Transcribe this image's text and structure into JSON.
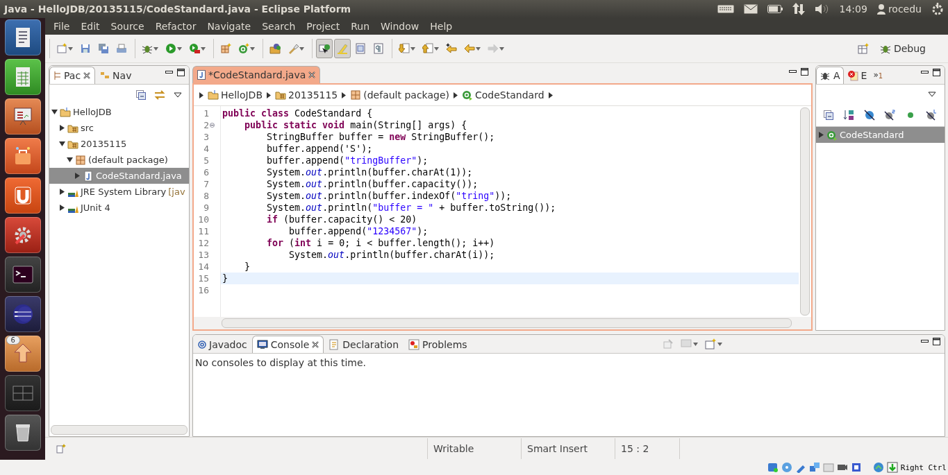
{
  "window": {
    "title": "Java - HelloJDB/20135115/CodeStandard.java - Eclipse Platform"
  },
  "top_panel": {
    "clock": "14:09",
    "user": "rocedu"
  },
  "launcher": [
    {
      "kind": "document"
    },
    {
      "kind": "spreadsheet"
    },
    {
      "kind": "presentation"
    },
    {
      "kind": "store"
    },
    {
      "kind": "cloud"
    },
    {
      "kind": "settings"
    },
    {
      "kind": "terminal"
    },
    {
      "kind": "eclipse"
    },
    {
      "kind": "updater",
      "badge": "6"
    },
    {
      "kind": "workspaces"
    },
    {
      "kind": "trash"
    }
  ],
  "menu": [
    "File",
    "Edit",
    "Source",
    "Refactor",
    "Navigate",
    "Search",
    "Project",
    "Run",
    "Window",
    "Help"
  ],
  "toolbar": [
    [
      {
        "kind": "new",
        "dropdown": true
      },
      {
        "kind": "save"
      },
      {
        "kind": "save_all"
      },
      {
        "kind": "print"
      }
    ],
    [
      {
        "kind": "debug",
        "dropdown": true
      },
      {
        "kind": "run",
        "dropdown": true
      },
      {
        "kind": "external",
        "dropdown": true
      }
    ],
    [
      {
        "kind": "new_package"
      },
      {
        "kind": "new_class",
        "dropdown": true
      }
    ],
    [
      {
        "kind": "open_type"
      },
      {
        "kind": "search",
        "dropdown": true
      }
    ],
    [
      {
        "kind": "breadcrumb",
        "pressed": true
      },
      {
        "kind": "highlight",
        "pressed": true
      },
      {
        "kind": "block",
        "pressed": false
      },
      {
        "kind": "whitespace",
        "pressed": false
      }
    ],
    [
      {
        "kind": "next",
        "dropdown": true
      },
      {
        "kind": "prev",
        "dropdown": true
      },
      {
        "kind": "last_edit"
      },
      {
        "kind": "back",
        "dropdown": true,
        "disabled": false
      },
      {
        "kind": "forward",
        "dropdown": true,
        "disabled": true
      }
    ]
  ],
  "perspective": {
    "label": "Debug"
  },
  "package_explorer": {
    "tabs": [
      {
        "label": "Pac",
        "selected": true
      },
      {
        "label": "Nav",
        "selected": false
      }
    ],
    "tree": [
      {
        "label": "HelloJDB",
        "kind": "project",
        "expanded": true,
        "selected": false,
        "children": [
          {
            "label": "src",
            "kind": "folder",
            "expanded": false,
            "selected": false
          },
          {
            "label": "20135115",
            "kind": "folder",
            "expanded": true,
            "selected": false,
            "children": [
              {
                "label": "(default package)",
                "kind": "package",
                "expanded": true,
                "selected": false,
                "children": [
                  {
                    "label": "CodeStandard.java",
                    "kind": "java",
                    "expanded": false,
                    "selected": true
                  }
                ]
              }
            ]
          },
          {
            "label": "JRE System Library",
            "suffix": "[jav",
            "kind": "library",
            "expanded": false,
            "selected": false
          },
          {
            "label": "JUnit 4",
            "kind": "library",
            "expanded": false,
            "selected": false
          }
        ]
      }
    ]
  },
  "editor": {
    "tab": {
      "label": "*CodeStandard.java",
      "selected": true
    },
    "breadcrumb": [
      {
        "label": "HelloJDB",
        "kind": "project"
      },
      {
        "label": "20135115",
        "kind": "folder"
      },
      {
        "label": "(default package)",
        "kind": "package"
      },
      {
        "label": "CodeStandard",
        "kind": "class"
      }
    ],
    "lines": [
      {
        "number": "1",
        "tokens": [
          {
            "kind": "keyword",
            "text": "public class"
          },
          {
            "kind": "plain",
            "text": " CodeStandard {"
          }
        ]
      },
      {
        "number": "2",
        "fold": true,
        "tokens": [
          {
            "kind": "keyword",
            "text": "    public static void"
          },
          {
            "kind": "plain",
            "text": " main(String[] args) {"
          }
        ]
      },
      {
        "number": "3",
        "tokens": [
          {
            "kind": "plain",
            "text": "        StringBuffer buffer = "
          },
          {
            "kind": "keyword",
            "text": "new"
          },
          {
            "kind": "plain",
            "text": " StringBuffer();"
          }
        ]
      },
      {
        "number": "4",
        "tokens": [
          {
            "kind": "plain",
            "text": "        buffer.append('S');"
          }
        ]
      },
      {
        "number": "5",
        "tokens": [
          {
            "kind": "plain",
            "text": "        buffer.append("
          },
          {
            "kind": "string",
            "text": "\"tringBuffer\""
          },
          {
            "kind": "plain",
            "text": ");"
          }
        ]
      },
      {
        "number": "6",
        "tokens": [
          {
            "kind": "plain",
            "text": "        System."
          },
          {
            "kind": "field",
            "text": "out"
          },
          {
            "kind": "plain",
            "text": ".println(buffer.charAt(1));"
          }
        ]
      },
      {
        "number": "7",
        "tokens": [
          {
            "kind": "plain",
            "text": "        System."
          },
          {
            "kind": "field",
            "text": "out"
          },
          {
            "kind": "plain",
            "text": ".println(buffer.capacity());"
          }
        ]
      },
      {
        "number": "8",
        "tokens": [
          {
            "kind": "plain",
            "text": "        System."
          },
          {
            "kind": "field",
            "text": "out"
          },
          {
            "kind": "plain",
            "text": ".println(buffer.indexOf("
          },
          {
            "kind": "string",
            "text": "\"tring\""
          },
          {
            "kind": "plain",
            "text": "));"
          }
        ]
      },
      {
        "number": "9",
        "tokens": [
          {
            "kind": "plain",
            "text": "        System."
          },
          {
            "kind": "field",
            "text": "out"
          },
          {
            "kind": "plain",
            "text": ".println("
          },
          {
            "kind": "string",
            "text": "\"buffer = \""
          },
          {
            "kind": "plain",
            "text": " + buffer.toString());"
          }
        ]
      },
      {
        "number": "10",
        "tokens": [
          {
            "kind": "keyword",
            "text": "        if"
          },
          {
            "kind": "plain",
            "text": " (buffer.capacity() < 20)"
          }
        ]
      },
      {
        "number": "11",
        "tokens": [
          {
            "kind": "plain",
            "text": "            buffer.append("
          },
          {
            "kind": "string",
            "text": "\"1234567\""
          },
          {
            "kind": "plain",
            "text": ");"
          }
        ]
      },
      {
        "number": "12",
        "tokens": [
          {
            "kind": "keyword",
            "text": "        for"
          },
          {
            "kind": "plain",
            "text": " ("
          },
          {
            "kind": "keyword",
            "text": "int"
          },
          {
            "kind": "plain",
            "text": " i = 0; i < buffer.length(); i++)"
          }
        ]
      },
      {
        "number": "13",
        "tokens": [
          {
            "kind": "plain",
            "text": "            System."
          },
          {
            "kind": "field",
            "text": "out"
          },
          {
            "kind": "plain",
            "text": ".println(buffer.charAt(i));"
          }
        ]
      },
      {
        "number": "14",
        "tokens": [
          {
            "kind": "plain",
            "text": "    }"
          }
        ]
      },
      {
        "number": "15",
        "current": true,
        "tokens": [
          {
            "kind": "plain",
            "text": "}"
          }
        ]
      },
      {
        "number": "16"
      }
    ]
  },
  "outline": {
    "tabs": [
      {
        "label": "A",
        "kind": "bug",
        "selected": true
      },
      {
        "label": "E",
        "kind": "error",
        "selected": false
      }
    ],
    "overflow": {
      "mark": "»",
      "count": "1"
    },
    "items": [
      {
        "label": "CodeStandard",
        "selected": true
      }
    ]
  },
  "bottom_panel": {
    "tabs": [
      {
        "label": "Javadoc",
        "kind": "at",
        "selected": false
      },
      {
        "label": "Console",
        "kind": "console",
        "selected": true
      },
      {
        "label": "Declaration",
        "kind": "declaration",
        "selected": false
      },
      {
        "label": "Problems",
        "kind": "problems",
        "selected": false
      }
    ],
    "message": "No consoles to display at this time."
  },
  "status_bar": {
    "fields": [
      "Writable",
      "Smart Insert",
      "15 : 2"
    ]
  },
  "vm_bar": {
    "host_key": "Right Ctrl"
  }
}
